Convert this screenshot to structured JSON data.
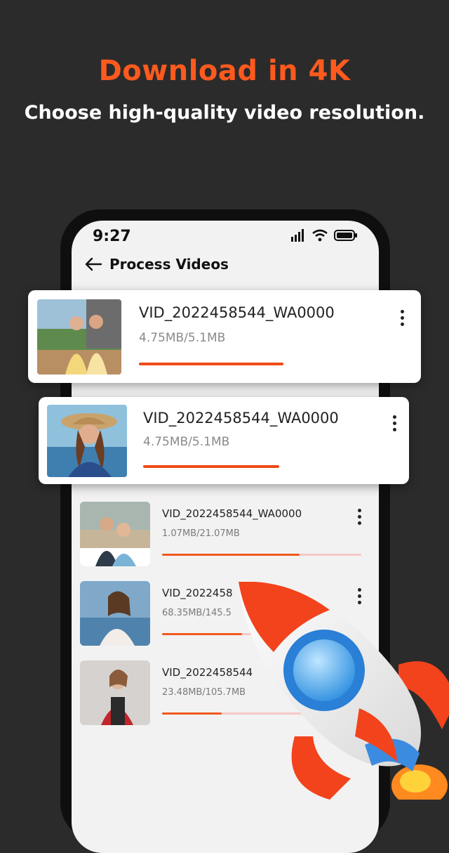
{
  "promo": {
    "headline": "Download in 4K",
    "subline": "Choose high-quality video resolution."
  },
  "status_bar": {
    "time": "9:27",
    "icons": [
      "signal-icon",
      "wifi-icon",
      "battery-icon"
    ]
  },
  "app_bar": {
    "title": "Process Videos",
    "back_icon": "arrow-left-icon"
  },
  "featured_cards": [
    {
      "name": "VID_2022458544_WA0000",
      "size": "4.75MB/5.1MB",
      "progress": 0.55
    },
    {
      "name": "VID_2022458544_WA0000",
      "size": "4.75MB/5.1MB",
      "progress": 0.54
    }
  ],
  "videos": [
    {
      "name": "VID_2022458544_WA0000",
      "size": "1.07MB/21.07MB",
      "progress": 0.69
    },
    {
      "name": "VID_2022458",
      "size": "68.35MB/145.5",
      "progress": 0.4
    },
    {
      "name": "VID_2022458544",
      "size": "23.48MB/105.7MB",
      "progress": 0.3
    }
  ],
  "colors": {
    "accent": "#fe5a1e",
    "background": "#2b2b2b",
    "progress_track": "#f7c8c8"
  },
  "decorations": [
    "rocket-illustration"
  ]
}
